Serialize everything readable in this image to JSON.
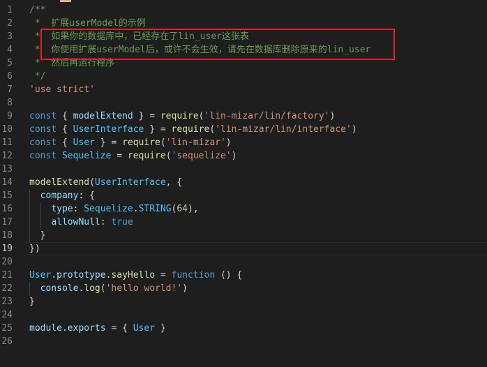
{
  "editor": {
    "top_fragment": "});",
    "active_line": 19,
    "lines": [
      {
        "n": "1",
        "segments": [
          {
            "t": "/**",
            "c": "c-comment"
          }
        ]
      },
      {
        "n": "2",
        "segments": [
          {
            "t": " *  扩展userModel的示例",
            "c": "c-comment"
          }
        ]
      },
      {
        "n": "3",
        "segments": [
          {
            "t": " *  如果你的数据库中，已经存在了lin_user这张表",
            "c": "c-comment"
          }
        ]
      },
      {
        "n": "4",
        "segments": [
          {
            "t": " *  你使用扩展userModel后，或许不会生效，请先在数据库删除原来的lin_user",
            "c": "c-comment"
          }
        ]
      },
      {
        "n": "5",
        "segments": [
          {
            "t": " *  然后再运行程序",
            "c": "c-comment"
          }
        ]
      },
      {
        "n": "6",
        "segments": [
          {
            "t": " */",
            "c": "c-comment"
          }
        ]
      },
      {
        "n": "7",
        "segments": [
          {
            "t": "'use strict'",
            "c": "c-str"
          }
        ]
      },
      {
        "n": "8",
        "segments": []
      },
      {
        "n": "9",
        "segments": [
          {
            "t": "const",
            "c": "c-key"
          },
          {
            "t": " { ",
            "c": "c-plain"
          },
          {
            "t": "modelExtend",
            "c": "c-var"
          },
          {
            "t": " } = ",
            "c": "c-plain"
          },
          {
            "t": "require",
            "c": "c-fn"
          },
          {
            "t": "(",
            "c": "c-plain"
          },
          {
            "t": "'lin-mizar/lin/factory'",
            "c": "c-str"
          },
          {
            "t": ")",
            "c": "c-plain"
          }
        ]
      },
      {
        "n": "10",
        "segments": [
          {
            "t": "const",
            "c": "c-key"
          },
          {
            "t": " { ",
            "c": "c-plain"
          },
          {
            "t": "UserInterface",
            "c": "c-type"
          },
          {
            "t": " } = ",
            "c": "c-plain"
          },
          {
            "t": "require",
            "c": "c-fn"
          },
          {
            "t": "(",
            "c": "c-plain"
          },
          {
            "t": "'lin-mizar/lin/interface'",
            "c": "c-str"
          },
          {
            "t": ")",
            "c": "c-plain"
          }
        ]
      },
      {
        "n": "11",
        "segments": [
          {
            "t": "const",
            "c": "c-key"
          },
          {
            "t": " { ",
            "c": "c-plain"
          },
          {
            "t": "User",
            "c": "c-type"
          },
          {
            "t": " } = ",
            "c": "c-plain"
          },
          {
            "t": "require",
            "c": "c-fn"
          },
          {
            "t": "(",
            "c": "c-plain"
          },
          {
            "t": "'lin-mizar'",
            "c": "c-str"
          },
          {
            "t": ")",
            "c": "c-plain"
          }
        ]
      },
      {
        "n": "12",
        "segments": [
          {
            "t": "const",
            "c": "c-key"
          },
          {
            "t": " ",
            "c": "c-plain"
          },
          {
            "t": "Sequelize",
            "c": "c-type"
          },
          {
            "t": " = ",
            "c": "c-plain"
          },
          {
            "t": "require",
            "c": "c-fn"
          },
          {
            "t": "(",
            "c": "c-plain"
          },
          {
            "t": "'sequelize'",
            "c": "c-str"
          },
          {
            "t": ")",
            "c": "c-plain"
          }
        ]
      },
      {
        "n": "13",
        "segments": []
      },
      {
        "n": "14",
        "segments": [
          {
            "t": "modelExtend",
            "c": "c-fn"
          },
          {
            "t": "(",
            "c": "c-plain"
          },
          {
            "t": "UserInterface",
            "c": "c-type"
          },
          {
            "t": ", {",
            "c": "c-plain"
          }
        ]
      },
      {
        "n": "15",
        "segments": [
          {
            "t": "  ",
            "c": "c-plain"
          },
          {
            "t": "company",
            "c": "c-var"
          },
          {
            "t": ": {",
            "c": "c-plain"
          }
        ]
      },
      {
        "n": "16",
        "segments": [
          {
            "t": "    ",
            "c": "c-plain"
          },
          {
            "t": "type",
            "c": "c-var"
          },
          {
            "t": ": ",
            "c": "c-plain"
          },
          {
            "t": "Sequelize",
            "c": "c-type"
          },
          {
            "t": ".",
            "c": "c-plain"
          },
          {
            "t": "STRING",
            "c": "c-type"
          },
          {
            "t": "(",
            "c": "c-plain"
          },
          {
            "t": "64",
            "c": "c-num"
          },
          {
            "t": "),",
            "c": "c-plain"
          }
        ]
      },
      {
        "n": "17",
        "segments": [
          {
            "t": "    ",
            "c": "c-plain"
          },
          {
            "t": "allowNull",
            "c": "c-var"
          },
          {
            "t": ": ",
            "c": "c-plain"
          },
          {
            "t": "true",
            "c": "c-key"
          }
        ]
      },
      {
        "n": "18",
        "segments": [
          {
            "t": "  }",
            "c": "c-plain"
          }
        ]
      },
      {
        "n": "19",
        "segments": [
          {
            "t": "})",
            "c": "c-plain"
          }
        ]
      },
      {
        "n": "20",
        "segments": []
      },
      {
        "n": "21",
        "segments": [
          {
            "t": "User",
            "c": "c-type"
          },
          {
            "t": ".",
            "c": "c-plain"
          },
          {
            "t": "prototype",
            "c": "c-var"
          },
          {
            "t": ".",
            "c": "c-plain"
          },
          {
            "t": "sayHello",
            "c": "c-fn"
          },
          {
            "t": " = ",
            "c": "c-plain"
          },
          {
            "t": "function",
            "c": "c-key"
          },
          {
            "t": " () {",
            "c": "c-plain"
          }
        ]
      },
      {
        "n": "22",
        "segments": [
          {
            "t": "  ",
            "c": "c-plain"
          },
          {
            "t": "console",
            "c": "c-var"
          },
          {
            "t": ".",
            "c": "c-plain"
          },
          {
            "t": "log",
            "c": "c-fn"
          },
          {
            "t": "(",
            "c": "c-plain"
          },
          {
            "t": "'hello world!'",
            "c": "c-str"
          },
          {
            "t": ")",
            "c": "c-plain"
          }
        ]
      },
      {
        "n": "23",
        "segments": [
          {
            "t": "}",
            "c": "c-plain"
          }
        ]
      },
      {
        "n": "24",
        "segments": []
      },
      {
        "n": "25",
        "segments": [
          {
            "t": "module",
            "c": "c-var"
          },
          {
            "t": ".",
            "c": "c-plain"
          },
          {
            "t": "exports",
            "c": "c-var"
          },
          {
            "t": " = { ",
            "c": "c-plain"
          },
          {
            "t": "User",
            "c": "c-type"
          },
          {
            "t": " }",
            "c": "c-plain"
          }
        ]
      },
      {
        "n": "26",
        "segments": []
      }
    ]
  },
  "colors": {
    "background": "#1e1e1e",
    "annotation_box": "#e81e25"
  }
}
